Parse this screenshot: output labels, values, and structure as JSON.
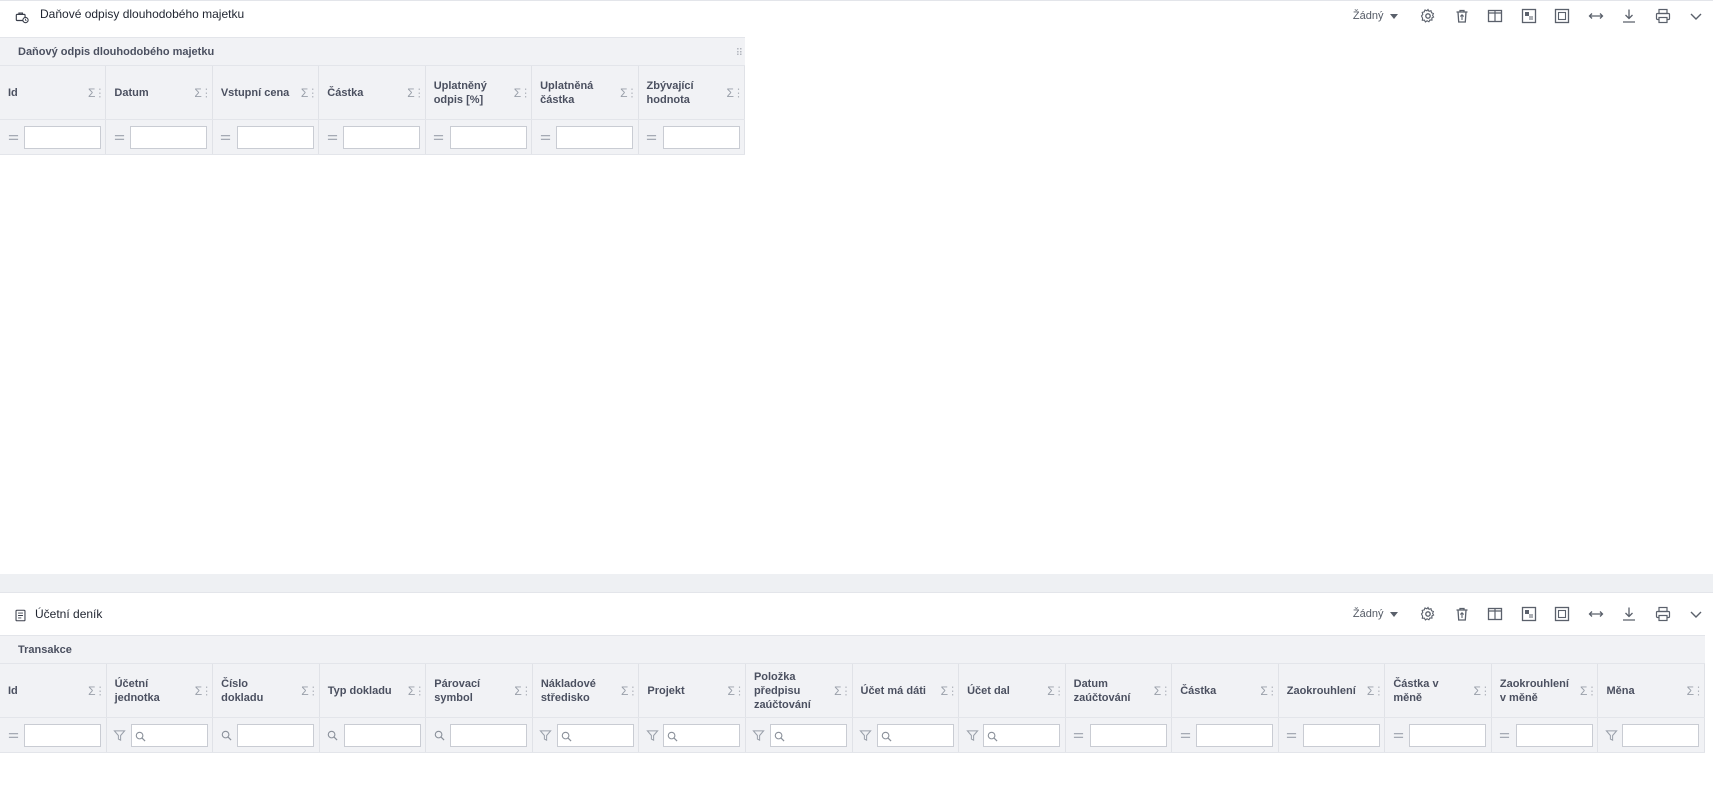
{
  "panel1": {
    "title": "Daňové odpisy dlouhodobého majetku",
    "toolbar_select": "Žádný",
    "group_label": "Daňový odpis dlouhodobého majetku",
    "columns": [
      {
        "label": "Id"
      },
      {
        "label": "Datum"
      },
      {
        "label": "Vstupní cena"
      },
      {
        "label": "Částka"
      },
      {
        "label": "Uplatněný odpis [%]"
      },
      {
        "label": "Uplatněná částka"
      },
      {
        "label": "Zbývající hodnota"
      }
    ]
  },
  "panel2": {
    "title": "Účetní deník",
    "toolbar_select": "Žádný",
    "group_label": "Transakce",
    "columns": [
      {
        "label": "Id",
        "filter": "equals"
      },
      {
        "label": "Účetní jednotka",
        "filter": "funnel-search"
      },
      {
        "label": "Číslo dokladu",
        "filter": "search"
      },
      {
        "label": "Typ dokladu",
        "filter": "search"
      },
      {
        "label": "Párovací symbol",
        "filter": "search"
      },
      {
        "label": "Nákladové středisko",
        "filter": "funnel-search"
      },
      {
        "label": "Projekt",
        "filter": "funnel-search"
      },
      {
        "label": "Položka předpisu zaúčtování",
        "filter": "funnel-search"
      },
      {
        "label": "Účet má dáti",
        "filter": "funnel-search"
      },
      {
        "label": "Účet dal",
        "filter": "funnel-search"
      },
      {
        "label": "Datum zaúčtování",
        "filter": "equals"
      },
      {
        "label": "Částka",
        "filter": "equals"
      },
      {
        "label": "Zaokrouhlení",
        "filter": "equals"
      },
      {
        "label": "Částka v měně",
        "filter": "equals"
      },
      {
        "label": "Zaokrouhlení v měně",
        "filter": "equals"
      },
      {
        "label": "Měna",
        "filter": "funnel"
      }
    ]
  },
  "symbols": {
    "sum": "Σ",
    "kebab": "⋮",
    "equals": "="
  }
}
